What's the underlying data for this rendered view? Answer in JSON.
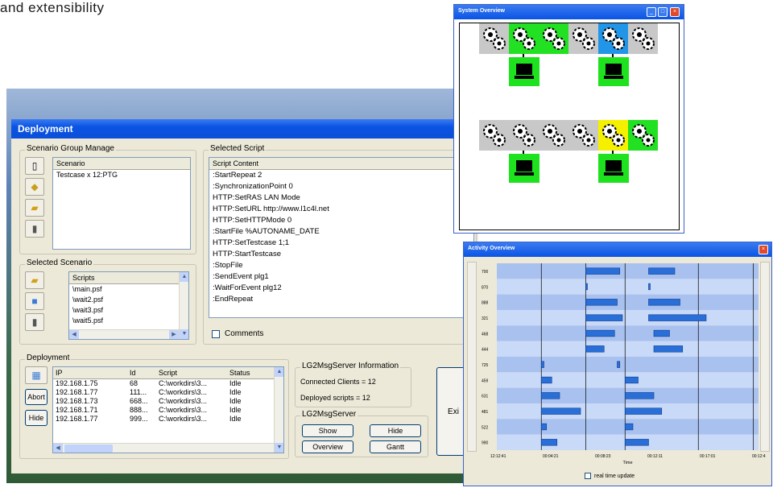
{
  "caption": "and extensibility",
  "deployment": {
    "title": "Deployment",
    "scenario_group": {
      "title": "Scenario Group Manage",
      "header": "Scenario",
      "items": [
        "Testcase x 12:PTG"
      ]
    },
    "selected_scenario": {
      "title": "Selected Scenario",
      "header": "Scripts",
      "items": [
        "\\main.psf",
        "\\wait2.psf",
        "\\wait3.psf",
        "\\wait5.psf"
      ]
    },
    "selected_script": {
      "title": "Selected Script",
      "header": "Script Content",
      "lines": [
        ":StartRepeat 2",
        ":SynchronizationPoint 0",
        "HTTP:SetRAS LAN Mode",
        "HTTP:SetURL http://www.l1c4l.net",
        "HTTP:SetHTTPMode 0",
        ":StartFile %AUTONAME_DATE",
        "HTTP:SetTestcase 1;1",
        "HTTP:StartTestcase",
        ":StopFile",
        ":SendEvent plg1",
        ":WaitForEvent plg12",
        ":EndRepeat"
      ],
      "comments_label": "Comments"
    },
    "deployment_group": {
      "title": "Deployment",
      "columns": [
        "IP",
        "Id",
        "Script",
        "Status"
      ],
      "rows": [
        [
          "192.168.1.75",
          "68",
          "C:\\workdirs\\3...",
          "Idle"
        ],
        [
          "192.168.1.77",
          "111...",
          "C:\\workdirs\\3...",
          "Idle"
        ],
        [
          "192.168.1.73",
          "668...",
          "C:\\workdirs\\3...",
          "Idle"
        ],
        [
          "192.168.1.71",
          "888...",
          "C:\\workdirs\\3...",
          "Idle"
        ],
        [
          "192.168.1.77",
          "999...",
          "C:\\workdirs\\3...",
          "Idle"
        ]
      ],
      "abort_label": "Abort",
      "hide_label": "Hide"
    },
    "server_info": {
      "title": "LG2MsgServer Information",
      "connected": "Connected Clients = 12",
      "deployed": "Deployed scripts = 12"
    },
    "server": {
      "title": "LG2MsgServer",
      "show_label": "Show",
      "hide_label": "Hide",
      "overview_label": "Overview",
      "gantt_label": "Gantt"
    },
    "exit_label": "Exi"
  },
  "system_overview": {
    "title": "System Overview",
    "gear_colors_top": [
      "#c8c8c8",
      "#22e022",
      "#22e022",
      "#c8c8c8",
      "#2196e8",
      "#c8c8c8"
    ],
    "gear_colors_bottom": [
      "#c8c8c8",
      "#c8c8c8",
      "#c8c8c8",
      "#c8c8c8",
      "#f4f000",
      "#22e022"
    ]
  },
  "activity_overview": {
    "title": "Activity Overview",
    "xlabel": "Time",
    "x_ticks": [
      "12:12:41",
      "00:04:21",
      "00:08:23",
      "00:12:11",
      "00:17:01",
      "00:12:4"
    ],
    "row_labels": [
      "700",
      "870",
      "888",
      "321",
      "468",
      "444",
      "725",
      "459",
      "631",
      "481",
      "522",
      "990"
    ],
    "realtime_label": "real time update",
    "bars": [
      [
        [
          0.34,
          0.47
        ],
        [
          0.58,
          0.68
        ]
      ],
      [
        [
          0.34,
          0.345
        ],
        [
          0.58,
          0.585
        ]
      ],
      [
        [
          0.34,
          0.46
        ],
        [
          0.58,
          0.7
        ]
      ],
      [
        [
          0.34,
          0.48
        ],
        [
          0.58,
          0.8
        ]
      ],
      [
        [
          0.34,
          0.45
        ],
        [
          0.6,
          0.66
        ]
      ],
      [
        [
          0.34,
          0.41
        ],
        [
          0.6,
          0.71
        ]
      ],
      [
        [
          0.17,
          0.18
        ],
        [
          0.46,
          0.47
        ]
      ],
      [
        [
          0.17,
          0.21
        ],
        [
          0.49,
          0.54
        ]
      ],
      [
        [
          0.17,
          0.24
        ],
        [
          0.49,
          0.6
        ]
      ],
      [
        [
          0.17,
          0.32
        ],
        [
          0.49,
          0.63
        ]
      ],
      [
        [
          0.17,
          0.19
        ],
        [
          0.49,
          0.52
        ]
      ],
      [
        [
          0.17,
          0.23
        ],
        [
          0.49,
          0.58
        ]
      ]
    ]
  }
}
